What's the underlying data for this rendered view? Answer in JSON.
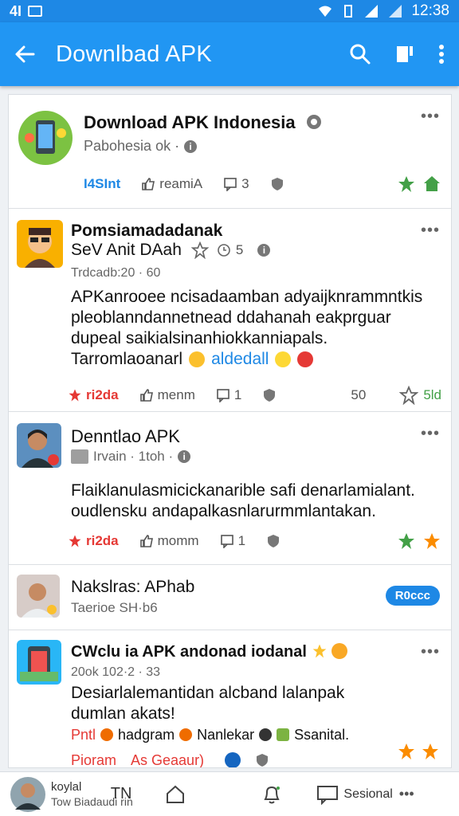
{
  "status_bar": {
    "left_text": "4I",
    "time": "12:38"
  },
  "app_bar": {
    "title": "Downlbad APK"
  },
  "posts": [
    {
      "name": "Download APK Indonesia",
      "subtitle": "Pabohesia ok ·",
      "actions": {
        "first": "I4SInt",
        "like": "reamiA",
        "comments": "3"
      }
    },
    {
      "name": "Pomsiamadadanak",
      "name2": "SeV Anit DAah",
      "count": "5",
      "timestamp": "Trdcadb:20 · 60",
      "body": "APKanrooee ncisadaamban adyaijknrammntkis pleoblanndannetnead ddahanah eakprguar dupeal saikialsinanhiokkanniapals.",
      "body2_text": "Tarromlaoanarl",
      "body2_link": "aldedall",
      "actions": {
        "first": "ri2da",
        "like": "menm",
        "comments": "1",
        "count": "50",
        "right": "5ld"
      }
    },
    {
      "name": "Denntlao APK",
      "subtitle": "Irvain · 1toh ·",
      "body": "Flaiklanulasmicickanarible safi denarlamialant. oudlensku andapalkasnlarurmmlantakan.",
      "actions": {
        "first": "ri2da",
        "like": "momm",
        "comments": "1"
      }
    },
    {
      "name": "Nakslras: APhab",
      "subtitle": "Taerioe SH·b6",
      "pill": "R0ccc"
    },
    {
      "name": "CWclu ia APK andonad iodanal",
      "timestamp": "20ok 102·2 · 33",
      "body": "Desiarlalemantidan alcband lalanpak dumlan akats!",
      "line2": [
        "Pntl",
        "hadgram",
        "Nanlekar",
        "Ssanital."
      ],
      "line3": [
        "Pioram",
        "As Geaaur)"
      ]
    }
  ],
  "bottom_nav": {
    "user_line1": "koylal",
    "user_line2": "Tow Biadaudi rin",
    "n1": "TN",
    "label": "Sesional"
  },
  "colors": {
    "primary": "#2196f3",
    "status": "#1e88e5",
    "red": "#e53935",
    "green": "#43a047",
    "orange": "#fb8c00"
  }
}
